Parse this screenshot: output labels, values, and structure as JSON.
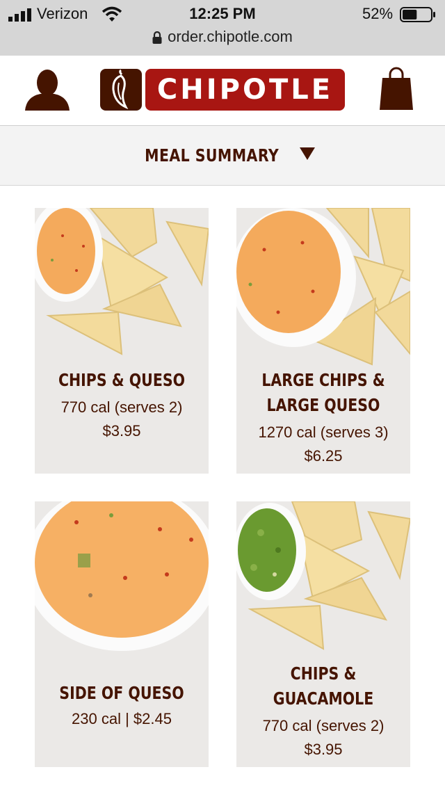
{
  "status_bar": {
    "carrier": "Verizon",
    "time": "12:25 PM",
    "battery": "52%",
    "battery_level": 0.52,
    "url": "order.chipotle.com"
  },
  "header": {
    "logo_text": "CHIPOTLE",
    "brand_color": "#a81612",
    "dark_color": "#451400",
    "user_icon": "user-icon",
    "bag_icon": "bag-icon"
  },
  "summary": {
    "label": "MEAL SUMMARY"
  },
  "menu": {
    "items": [
      {
        "name_line1": "CHIPS & QUESO",
        "name_line2": "",
        "cal": "770 cal  (serves 2)",
        "price": "$3.95"
      },
      {
        "name_line1": "LARGE CHIPS &",
        "name_line2": "LARGE QUESO",
        "cal": "1270 cal  (serves 3)",
        "price": "$6.25"
      },
      {
        "name_line1": "SIDE OF QUESO",
        "name_line2": "",
        "cal": "230 cal  | $2.45",
        "price": ""
      },
      {
        "name_line1": "CHIPS &",
        "name_line2": "GUACAMOLE",
        "cal": "770 cal  (serves 2)",
        "price": "$3.95"
      }
    ]
  }
}
